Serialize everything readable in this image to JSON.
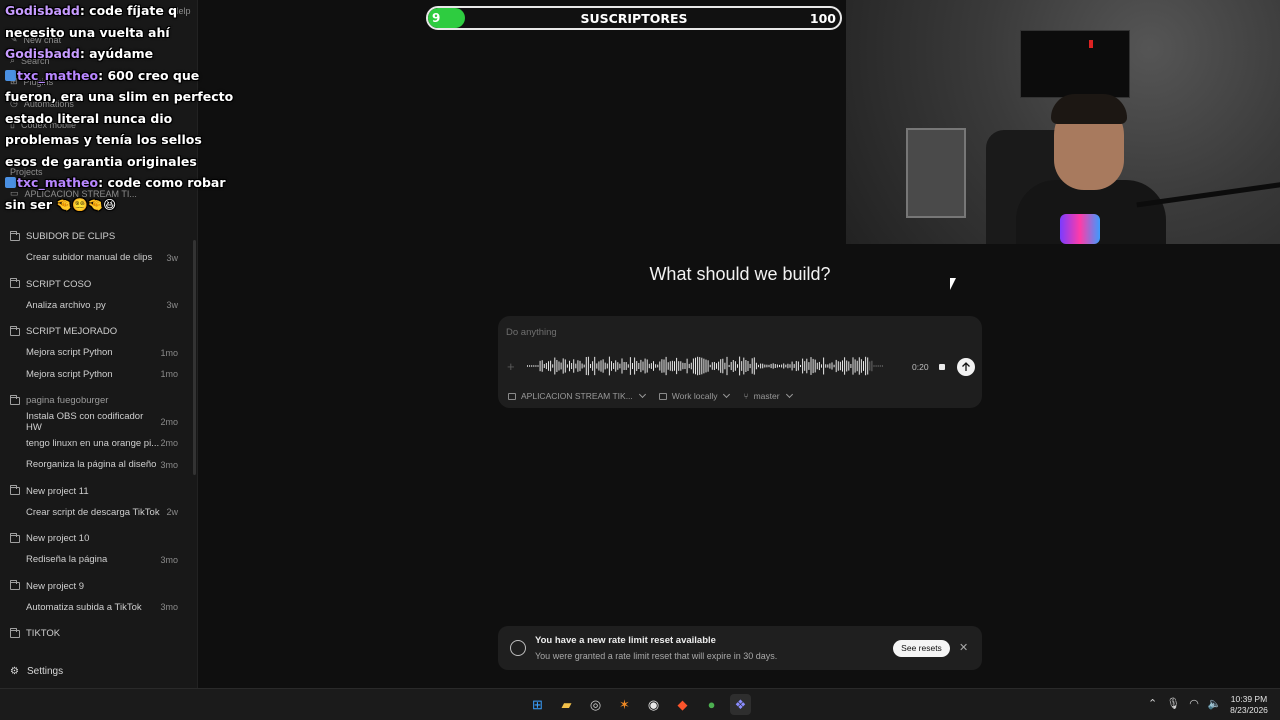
{
  "sidebar": {
    "top_items": [
      {
        "label": "New chat",
        "icon": "edit-icon"
      },
      {
        "label": "Search",
        "icon": "search-icon"
      },
      {
        "label": "Plugins",
        "icon": "plugin-icon"
      },
      {
        "label": "Automations",
        "icon": "clock-icon"
      },
      {
        "label": "Codex mobile",
        "icon": "phone-icon"
      }
    ],
    "help_label": "Help",
    "projects_label": "Projects",
    "pinned_project": "APLICACION STREAM TI...",
    "projects": [
      {
        "name": "SUBIDOR DE CLIPS",
        "chats": [
          {
            "title": "Crear subidor manual de clips",
            "age": "3w"
          }
        ]
      },
      {
        "name": "SCRIPT COSO",
        "chats": [
          {
            "title": "Analiza archivo .py",
            "age": "3w"
          }
        ]
      },
      {
        "name": "SCRIPT MEJORADO",
        "chats": [
          {
            "title": "Mejora script Python",
            "age": "1mo"
          },
          {
            "title": "Mejora script Python",
            "age": "1mo"
          }
        ]
      },
      {
        "name": "pagina fuegoburger",
        "chats": [
          {
            "title": "Instala OBS con codificador HW",
            "age": "2mo"
          },
          {
            "title": "tengo linuxn en una orange pi...",
            "age": "2mo"
          },
          {
            "title": "Reorganiza la página al diseño",
            "age": "3mo"
          }
        ]
      },
      {
        "name": "New project 11",
        "chats": [
          {
            "title": "Crear script de descarga TikTok",
            "age": "2w"
          }
        ]
      },
      {
        "name": "New project 10",
        "chats": [
          {
            "title": "Rediseña la página",
            "age": "3mo"
          }
        ]
      },
      {
        "name": "New project 9",
        "chats": [
          {
            "title": "Automatiza subida a TikTok",
            "age": "3mo"
          }
        ]
      },
      {
        "name": "TIKTOK",
        "chats": []
      }
    ],
    "settings_label": "Settings"
  },
  "stream_chat": [
    {
      "user": "Godisbadd",
      "text": ": code fíjate q necesito una vuelta ahí",
      "badge": false
    },
    {
      "user": "Godisbadd",
      "text": ": ayúdame",
      "badge": false
    },
    {
      "user": "txc_matheo",
      "text": ": 600 creo que fueron, era una slim en perfecto estado literal nunca dio problemas y tenía los sellos esos de garantia originales",
      "badge": true
    },
    {
      "user": "txc_matheo",
      "text": ": code como robar sin ser 🤏😵‍💫🤏😆",
      "badge": true
    }
  ],
  "subscriber_goal": {
    "current": "9",
    "label": "SUSCRIPTORES",
    "goal": "100",
    "progress": 0.09,
    "fill_color": "#2ecc40"
  },
  "main": {
    "heading": "What should we build?",
    "composer": {
      "placeholder": "Do anything",
      "recording_time": "0:20",
      "project_selector": "APLICACION STREAM TIK...",
      "location_selector": "Work locally",
      "branch_selector": "master"
    },
    "notification": {
      "title": "You have a new rate limit reset available",
      "body": "You were granted a rate limit reset that will expire in 30 days.",
      "button": "See resets"
    }
  },
  "taskbar": {
    "apps": [
      "windows-start",
      "file-explorer",
      "steam",
      "media-app",
      "obs",
      "brave",
      "chrome",
      "codex"
    ],
    "time": "10:39 PM",
    "date": "8/23/2026"
  }
}
